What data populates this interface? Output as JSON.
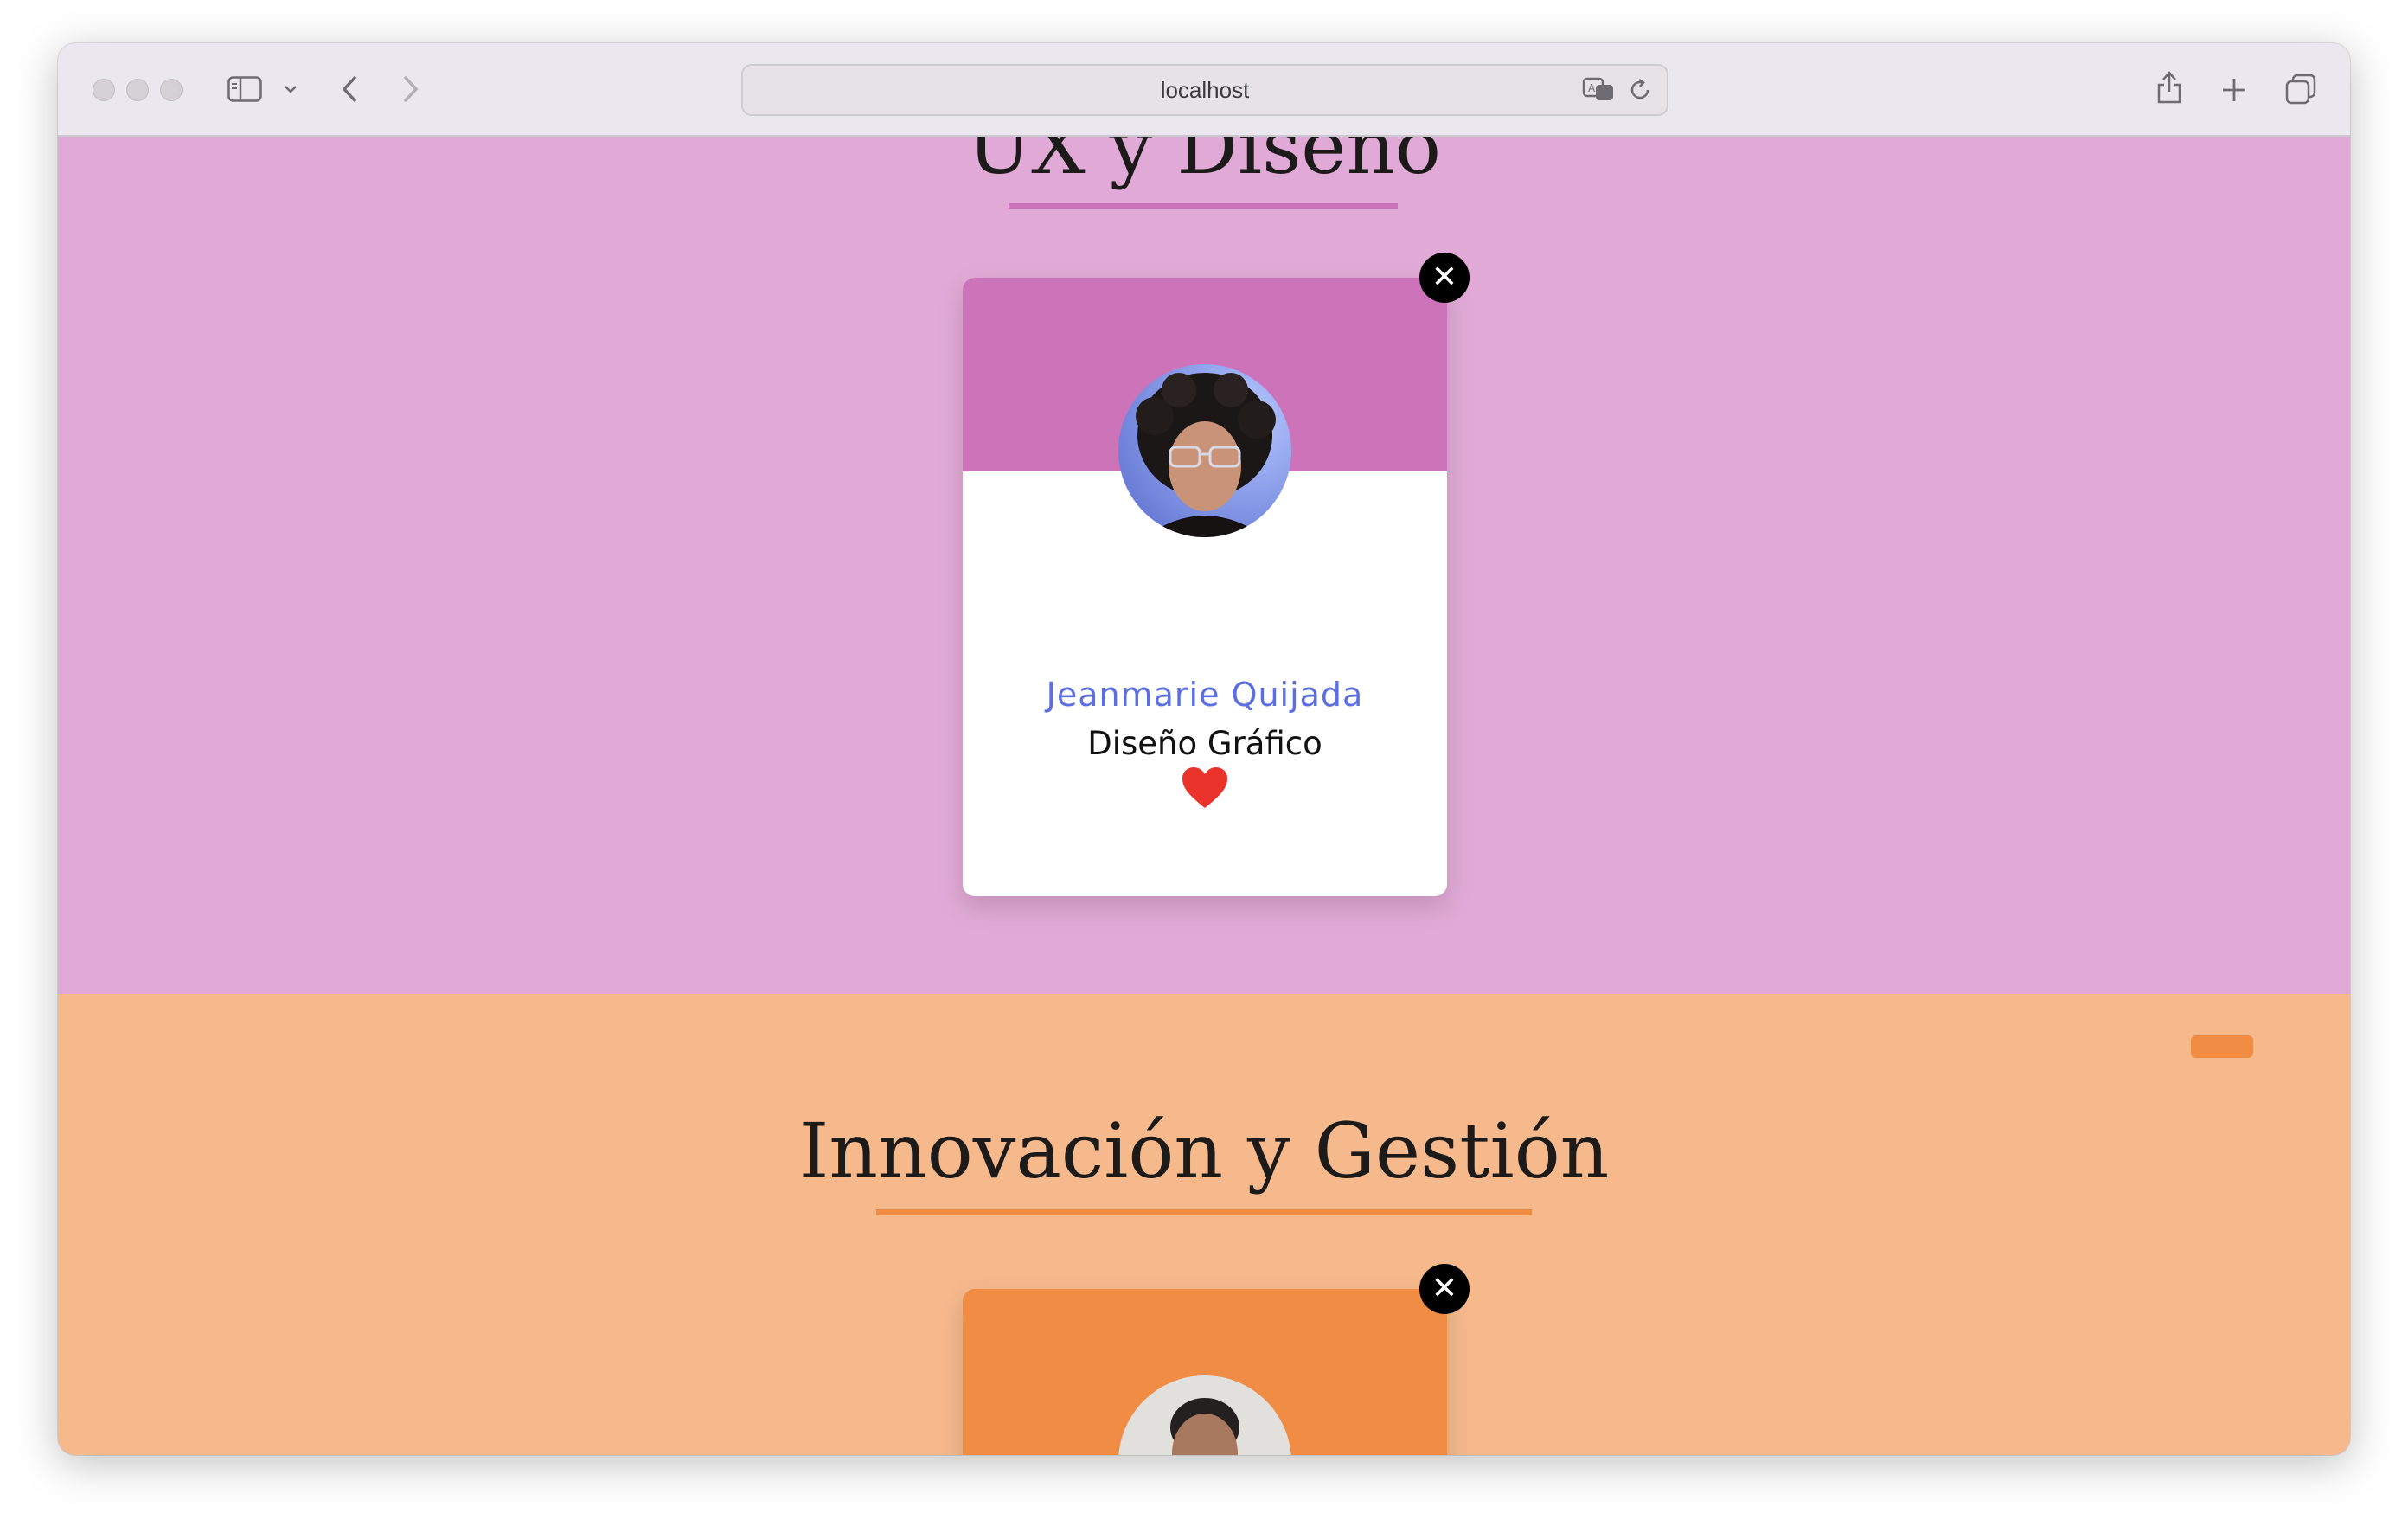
{
  "browser": {
    "url": "localhost",
    "icons": {
      "sidebar": "sidebar-icon",
      "chevron": "chevron-down-icon",
      "back": "back-arrow-icon",
      "forward": "forward-arrow-icon",
      "translate": "translate-icon",
      "reload": "reload-icon",
      "share": "share-icon",
      "new_tab": "plus-icon",
      "tabs": "tabs-overview-icon"
    }
  },
  "sections": {
    "ux": {
      "title": "UX y Diseño",
      "accent": "#cc73b9",
      "background": "#e1aad6",
      "card": {
        "name": "Jeanmarie Quijada",
        "role": "Diseño Gráfico",
        "close_label": "✕",
        "name_color": "#5b6fe0"
      }
    },
    "innovation": {
      "title": "Innovación y Gestión",
      "accent": "#f08c43",
      "background": "#f5b98c",
      "card": {
        "close_label": "✕"
      }
    }
  }
}
